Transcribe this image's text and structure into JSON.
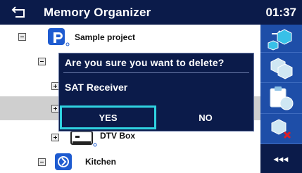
{
  "header": {
    "title": "Memory Organizer",
    "time": "01:37",
    "back_icon": "back-arrow-icon"
  },
  "tree": {
    "nodes": [
      {
        "label": "Sample project",
        "expander": "minus",
        "icon": "project-icon",
        "level": 1
      },
      {
        "label": "",
        "expander": "minus",
        "level": 2
      },
      {
        "label": "",
        "expander": "plus",
        "level": 3
      },
      {
        "label": "",
        "expander": "plus",
        "level": 3,
        "selected": true
      },
      {
        "label": "DTV Box",
        "expander": "plus",
        "icon": "device-icon",
        "level": 3
      },
      {
        "label": "Kitchen",
        "expander": "minus",
        "icon": "node-icon",
        "level": 2
      }
    ]
  },
  "dialog": {
    "question": "Are you sure you want to delete?",
    "item": "SAT Receiver",
    "yes_label": "YES",
    "no_label": "NO"
  },
  "sidebar": {
    "buttons": [
      {
        "icon": "add-node-icon"
      },
      {
        "icon": "clone-icon"
      },
      {
        "icon": "paste-icon"
      },
      {
        "icon": "delete-icon"
      },
      {
        "label": "◂◂◂",
        "icon": "collapse-icon"
      }
    ]
  },
  "colors": {
    "header_bg": "#0b1b4a",
    "sidebar_bg": "#1e4ea8",
    "dialog_bg": "#0b1b4a",
    "focus_border": "#2fd2e0",
    "selected_row": "#cfcfcf"
  }
}
